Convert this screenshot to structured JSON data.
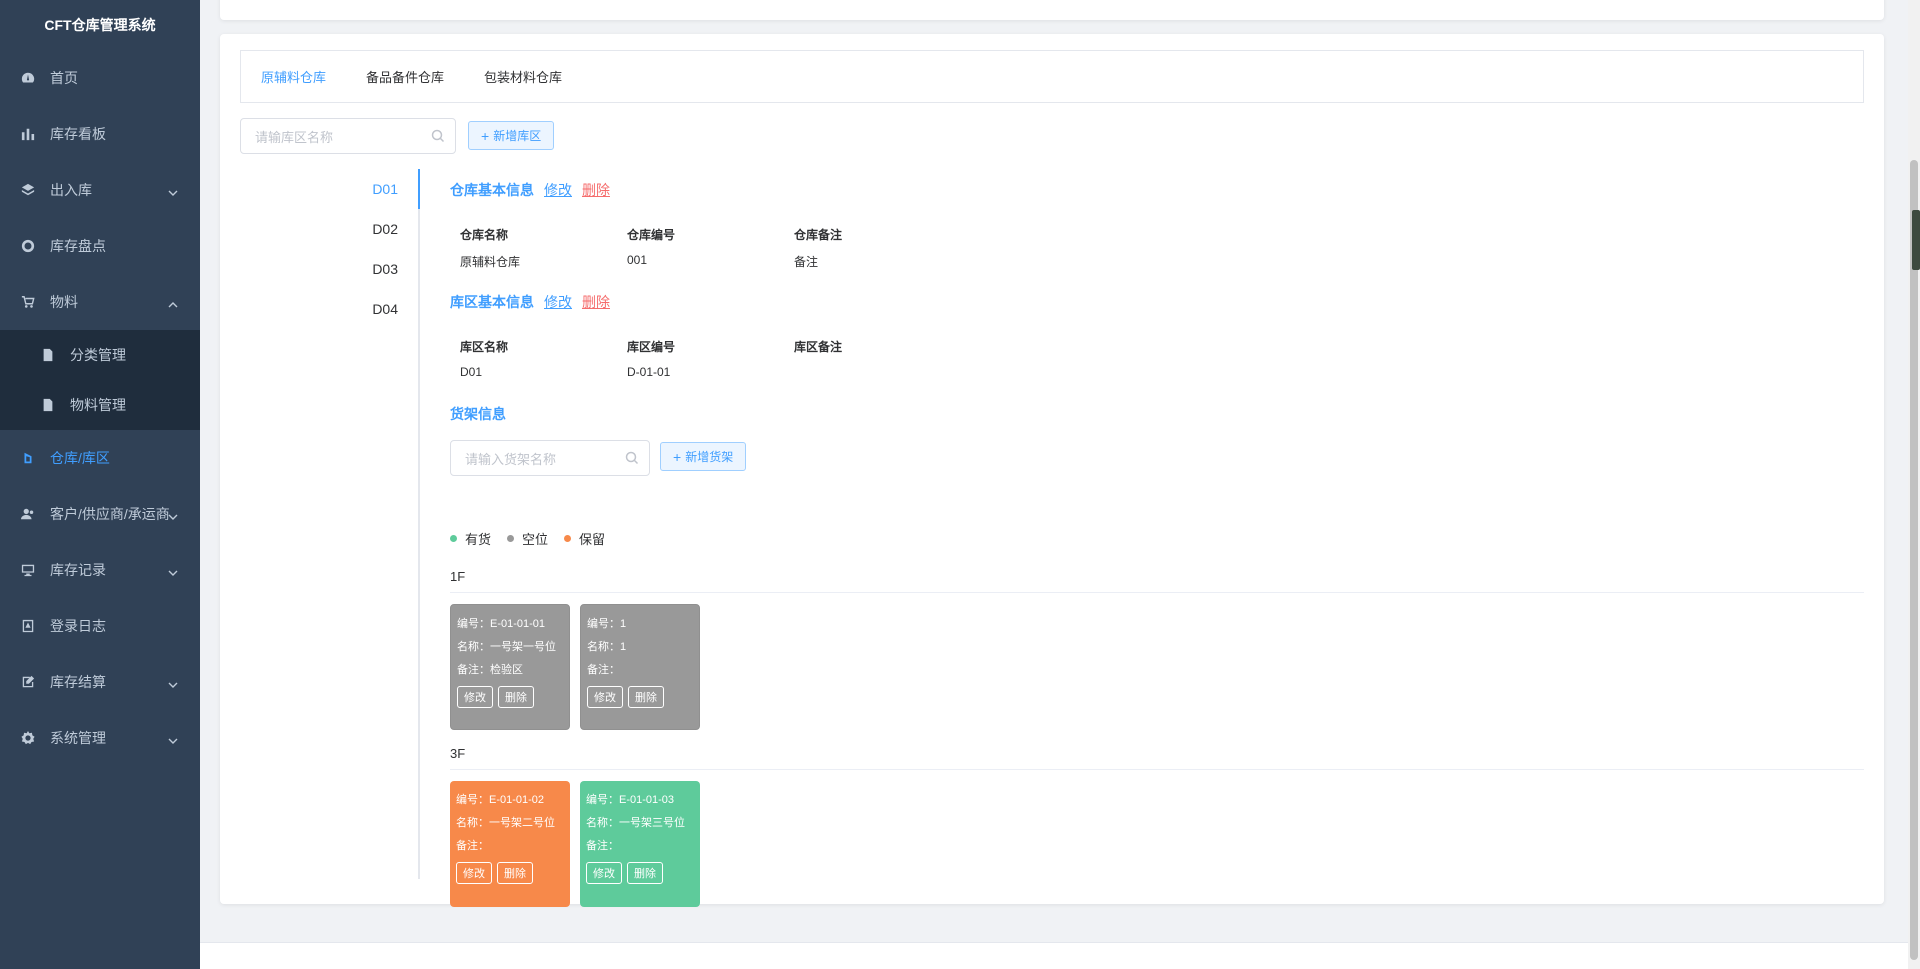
{
  "app": {
    "title": "CFT仓库管理系统"
  },
  "sidebar": {
    "items": [
      {
        "label": "首页",
        "icon": "dashboard-icon"
      },
      {
        "label": "库存看板",
        "icon": "bar-chart-icon"
      },
      {
        "label": "出入库",
        "icon": "layers-icon",
        "expandable": true
      },
      {
        "label": "库存盘点",
        "icon": "aperture-icon"
      },
      {
        "label": "物料",
        "icon": "cart-icon",
        "expandable": true,
        "expanded": true
      },
      {
        "label": "仓库/库区",
        "icon": "warehouse-icon",
        "active": true
      },
      {
        "label": "客户/供应商/承运商",
        "icon": "user-icon",
        "expandable": true
      },
      {
        "label": "库存记录",
        "icon": "monitor-icon",
        "expandable": true
      },
      {
        "label": "登录日志",
        "icon": "log-icon"
      },
      {
        "label": "库存结算",
        "icon": "edit-icon",
        "expandable": true
      },
      {
        "label": "系统管理",
        "icon": "gear-icon",
        "expandable": true
      }
    ],
    "submenu": [
      {
        "label": "分类管理",
        "icon": "document-icon"
      },
      {
        "label": "物料管理",
        "icon": "document-icon"
      }
    ]
  },
  "tabs": [
    {
      "label": "原辅料仓库",
      "active": true
    },
    {
      "label": "备品备件仓库"
    },
    {
      "label": "包装材料仓库"
    }
  ],
  "zone_search": {
    "placeholder": "请输库区名称"
  },
  "add_zone_button": "新增库区",
  "zones": [
    {
      "label": "D01",
      "active": true
    },
    {
      "label": "D02"
    },
    {
      "label": "D03"
    },
    {
      "label": "D04"
    }
  ],
  "warehouse_info": {
    "title": "仓库基本信息",
    "edit": "修改",
    "delete": "删除",
    "name_label": "仓库名称",
    "name": "原辅料仓库",
    "code_label": "仓库编号",
    "code": "001",
    "remark_label": "仓库备注",
    "remark": "备注"
  },
  "zone_info": {
    "title": "库区基本信息",
    "edit": "修改",
    "delete": "删除",
    "name_label": "库区名称",
    "name": "D01",
    "code_label": "库区编号",
    "code": "D-01-01",
    "remark_label": "库区备注",
    "remark": ""
  },
  "shelf_info": {
    "title": "货架信息",
    "search_placeholder": "请输入货架名称",
    "add_button": "新增货架"
  },
  "legend": [
    {
      "label": "有货",
      "color": "#5ecb9b"
    },
    {
      "label": "空位",
      "color": "#999999"
    },
    {
      "label": "保留",
      "color": "#f7894a"
    }
  ],
  "floors": [
    {
      "label": "1F",
      "shelves": [
        {
          "code_line": "编号：E-01-01-01",
          "name_line": "名称：一号架一号位",
          "remark_line": "备注：检验区",
          "status": "gray",
          "edit": "修改",
          "delete": "删除"
        },
        {
          "code_line": "编号：1",
          "name_line": "名称：1",
          "remark_line": "备注：",
          "status": "gray",
          "edit": "修改",
          "delete": "删除"
        }
      ]
    },
    {
      "label": "3F",
      "shelves": [
        {
          "code_line": "编号：E-01-01-02",
          "name_line": "名称：一号架二号位",
          "remark_line": "备注：",
          "status": "orange",
          "edit": "修改",
          "delete": "删除"
        },
        {
          "code_line": "编号：E-01-01-03",
          "name_line": "名称：一号架三号位",
          "remark_line": "备注：",
          "status": "green",
          "edit": "修改",
          "delete": "删除"
        }
      ]
    }
  ]
}
